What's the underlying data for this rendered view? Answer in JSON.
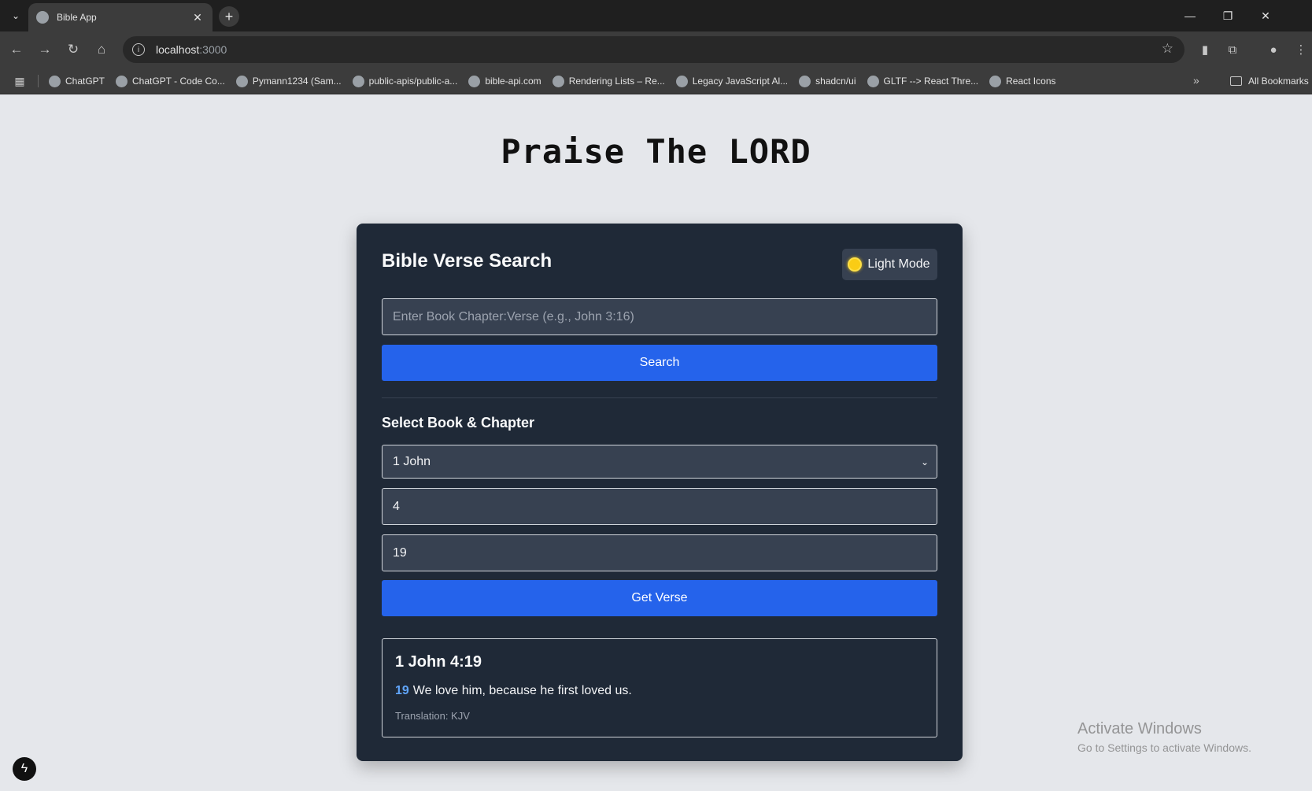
{
  "browser": {
    "tab_title": "Bible App",
    "url_host": "localhost",
    "url_port": ":3000",
    "bookmarks": [
      {
        "label": "ChatGPT",
        "icon": "openai-icon"
      },
      {
        "label": "ChatGPT - Code Co...",
        "icon": "openai-icon"
      },
      {
        "label": "Pymann1234 (Sam...",
        "icon": "github-icon"
      },
      {
        "label": "public-apis/public-a...",
        "icon": "github-icon"
      },
      {
        "label": "bible-api.com",
        "icon": "globe-icon"
      },
      {
        "label": "Rendering Lists – Re...",
        "icon": "react-icon"
      },
      {
        "label": "Legacy JavaScript Al...",
        "icon": "fcc-icon"
      },
      {
        "label": "shadcn/ui",
        "icon": "shadcn-icon"
      },
      {
        "label": "GLTF --> React Thre...",
        "icon": "pmndrs-icon"
      },
      {
        "label": "React Icons",
        "icon": "react-icons-icon"
      }
    ],
    "all_bookmarks_label": "All Bookmarks"
  },
  "page": {
    "title": "Praise The LORD"
  },
  "card": {
    "heading": "Bible Verse Search",
    "mode_button_label": "Light Mode",
    "search_placeholder": "Enter Book Chapter:Verse (e.g., John 3:16)",
    "search_button_label": "Search",
    "section_label": "Select Book & Chapter",
    "selected_book": "1 John",
    "chapter_value": "4",
    "verse_value": "19",
    "get_verse_button_label": "Get Verse"
  },
  "result": {
    "reference": "1 John 4:19",
    "verse_number": "19",
    "verse_text": "We love him, because he first loved us.",
    "translation": "Translation: KJV"
  },
  "watermark": {
    "title": "Activate Windows",
    "subtitle": "Go to Settings to activate Windows."
  },
  "colors": {
    "page_bg": "#e5e7eb",
    "card_bg": "#1f2937",
    "input_bg": "#374151",
    "primary_button": "#2563eb",
    "verse_number": "#60a5fa"
  }
}
